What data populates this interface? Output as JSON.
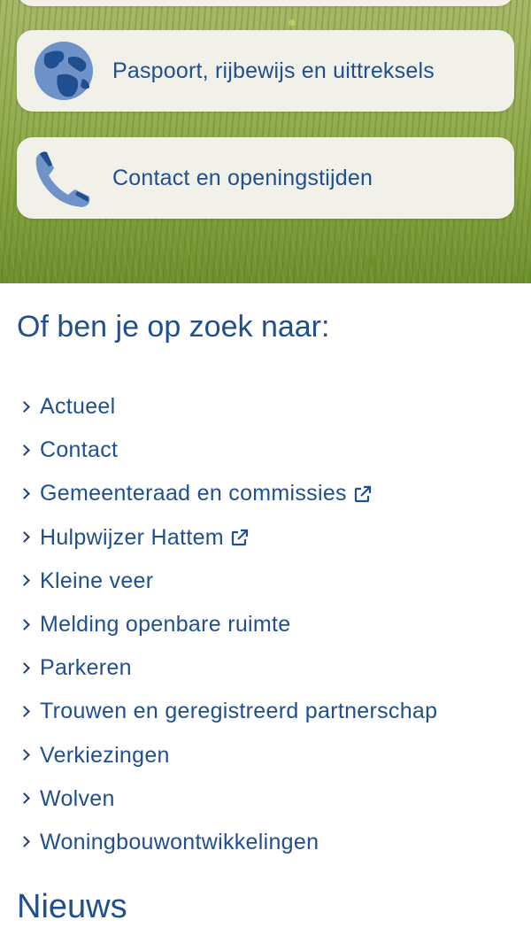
{
  "hero": {
    "cards": [
      {
        "label": "Paspoort, rijbewijs en uittreksels",
        "icon": "globe-icon"
      },
      {
        "label": "Contact en openingstijden",
        "icon": "phone-icon"
      }
    ]
  },
  "search": {
    "title": "Of ben je op zoek naar:",
    "links": [
      {
        "label": "Actueel",
        "external": false
      },
      {
        "label": "Contact",
        "external": false
      },
      {
        "label": "Gemeenteraad en commissies",
        "external": true
      },
      {
        "label": "Hulpwijzer Hattem",
        "external": true
      },
      {
        "label": "Kleine veer",
        "external": false
      },
      {
        "label": "Melding openbare ruimte",
        "external": false
      },
      {
        "label": "Parkeren",
        "external": false
      },
      {
        "label": "Trouwen en geregistreerd partnerschap",
        "external": false
      },
      {
        "label": "Verkiezingen",
        "external": false
      },
      {
        "label": "Wolven",
        "external": false
      },
      {
        "label": "Woningbouwontwikkelingen",
        "external": false
      }
    ]
  },
  "news": {
    "title": "Nieuws"
  },
  "colors": {
    "primary": "#1f4f8f",
    "card_bg": "#f1f1ea",
    "icon_blue": "#6f93c8",
    "icon_dark": "#1f4f8f"
  }
}
